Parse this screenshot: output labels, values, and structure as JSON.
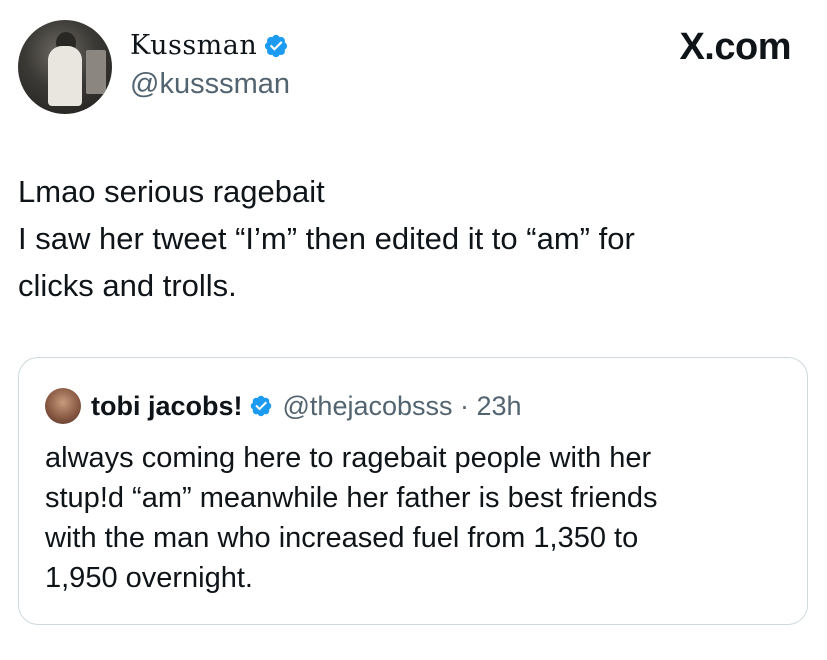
{
  "author": {
    "display_name": "Kussman",
    "handle": "@kusssman",
    "verified_icon": "verified-badge-icon"
  },
  "brand": "X.com",
  "tweet": {
    "lines": [
      "Lmao serious ragebait",
      "I saw her tweet “I’m” then edited it to “am” for",
      "clicks and trolls."
    ]
  },
  "quoted": {
    "display_name": "tobi jacobs!",
    "handle_time": "@thejacobsss · 23h",
    "lines": [
      "always coming here to ragebait people with her",
      "stup!d “am” meanwhile her father is best friends",
      "with the man who increased fuel from 1,350 to",
      "1,950 overnight."
    ]
  },
  "colors": {
    "verified": "#1d9bf0",
    "text": "#0f1419",
    "secondary": "#536471",
    "border": "#cfd9de"
  }
}
